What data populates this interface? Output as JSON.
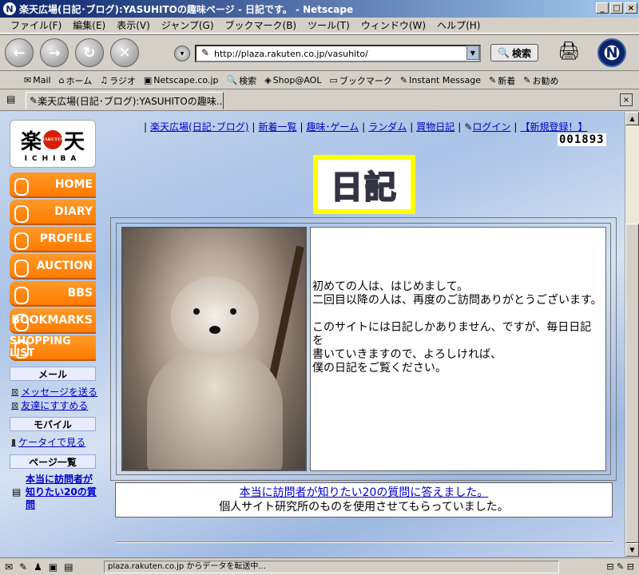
{
  "window": {
    "title": "楽天広場(日記･ブログ):YASUHITOの趣味ページ - 日記です。 - Netscape",
    "min": "_",
    "max": "□",
    "close": "×"
  },
  "menu": [
    "ファイル(F)",
    "編集(E)",
    "表示(V)",
    "ジャンプ(G)",
    "ブックマーク(B)",
    "ツール(T)",
    "ウィンドウ(W)",
    "ヘルプ(H)"
  ],
  "nav": {
    "back": "←",
    "forward": "→",
    "reload": "↻",
    "stop": "✕",
    "url": "http://plaza.rakuten.co.jp/vasuhito/",
    "search_label": "検索"
  },
  "personal_toolbar": [
    "Mail",
    "ホーム",
    "ラジオ",
    "Netscape.co.jp",
    "検索",
    "Shop@AOL",
    "ブックマーク",
    "Instant Message",
    "新着",
    "お勧め"
  ],
  "tab": {
    "label": "楽天広場(日記･ブログ):YASUHITOの趣味...",
    "close": "×"
  },
  "logo": {
    "left": "楽",
    "dot": "RAKUTEN",
    "right": "天",
    "sub": "ICHIBA"
  },
  "side_buttons": [
    "HOME",
    "DIARY",
    "PROFILE",
    "AUCTION",
    "BBS",
    "BOOKMARKS",
    "SHOPPING LIST"
  ],
  "sidebar": {
    "mail_head": "メール",
    "mail_links": [
      "メッセージを送る",
      "友達にすすめる"
    ],
    "mobile_head": "モバイル",
    "mobile_link": "ケータイで見る",
    "pages_head": "ページ一覧",
    "pages_link": "本当に訪問者が知りたい20の質問"
  },
  "top_links": [
    "楽天広場(日記･ブログ)",
    "新着一覧",
    "趣味･ゲーム",
    "ランダム",
    "買物日記",
    "ログイン",
    "【新規登録！】"
  ],
  "counter": "001893",
  "banner": "日記",
  "intro_text": "初めての人は、はじめまして。\n二回目以降の人は、再度のご訪問ありがとうございます。\n\nこのサイトには日記しかありません、ですが、毎日日記を\n書いていきますので、よろしければ、\n僕の日記をご覧ください。",
  "bottom": {
    "link": "本当に訪問者が知りたい20の質問に答えました。",
    "text": "個人サイト研究所のものを使用させてもらっていました。"
  },
  "status": {
    "text": "plaza.rakuten.co.jp からデータを転送中..."
  }
}
